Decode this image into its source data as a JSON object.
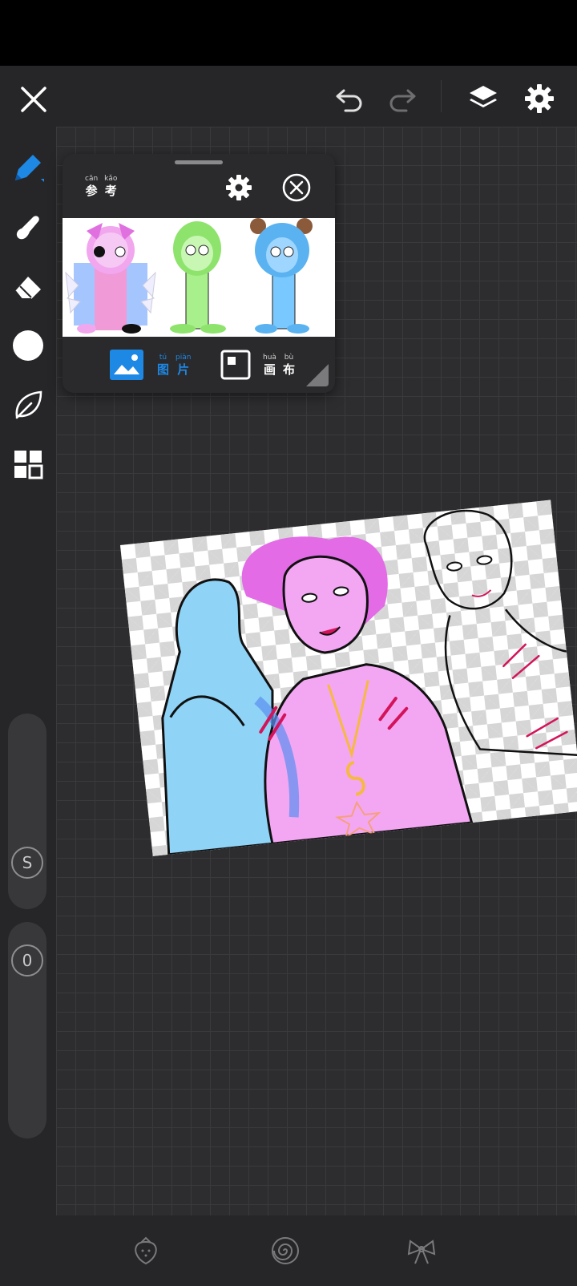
{
  "toolbar": {
    "close_icon": "close-icon",
    "undo_icon": "undo-icon",
    "redo_icon": "redo-icon",
    "layers_icon": "layers-icon",
    "settings_icon": "gear-icon"
  },
  "sidebar": {
    "tools": [
      {
        "name": "pen",
        "icon": "pen-icon",
        "active": true
      },
      {
        "name": "smudge",
        "icon": "smudge-icon"
      },
      {
        "name": "eraser",
        "icon": "eraser-icon"
      },
      {
        "name": "color",
        "icon": "color-swatch-icon",
        "color": "#ffffff"
      },
      {
        "name": "leaf",
        "icon": "leaf-icon"
      },
      {
        "name": "grid",
        "icon": "grid-icon"
      }
    ],
    "size_slider_label": "S",
    "opacity_slider_label": "0"
  },
  "reference_panel": {
    "title": [
      {
        "pinyin": "cān",
        "char": "参"
      },
      {
        "pinyin": "kǎo",
        "char": "考"
      }
    ],
    "tab_image": [
      {
        "pinyin": "tú",
        "char": "图"
      },
      {
        "pinyin": "piàn",
        "char": "片"
      }
    ],
    "tab_canvas": [
      {
        "pinyin": "huà",
        "char": "画"
      },
      {
        "pinyin": "bù",
        "char": "布"
      }
    ],
    "active_tab": "image"
  },
  "colors": {
    "accent": "#1e88e5",
    "background": "#2b2b2d",
    "toolbar": "#262628"
  },
  "bottom_bar": {
    "icons": [
      "strawberry-icon",
      "spiral-icon",
      "bow-icon"
    ]
  }
}
